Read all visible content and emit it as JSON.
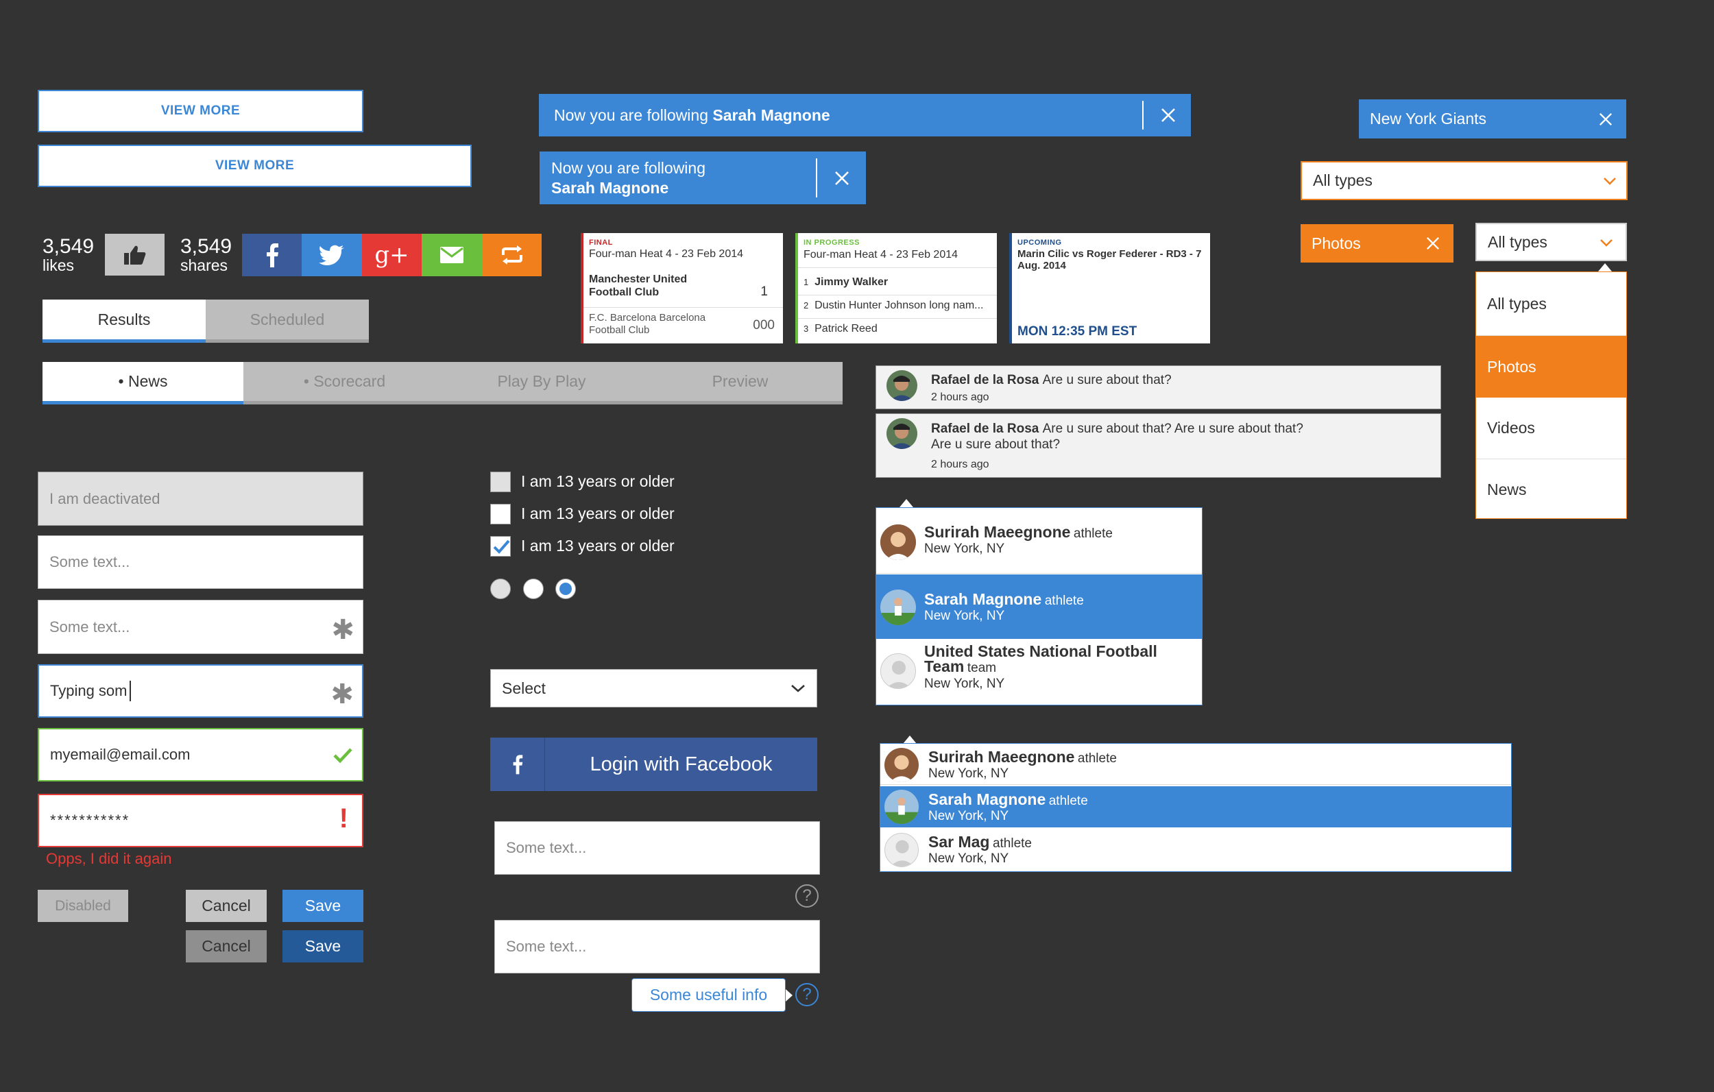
{
  "view_more": {
    "label": "VIEW MORE"
  },
  "follow": {
    "prefix": "Now you are following",
    "prefix2": "Now you are following",
    "name": "Sarah Magnone"
  },
  "team_tag": {
    "label": "New York Giants"
  },
  "filter": {
    "all_types": "All types",
    "photos": "Photos",
    "options": [
      "All types",
      "Photos",
      "Videos",
      "News"
    ]
  },
  "social": {
    "likes_count": "3,549",
    "likes_label": "likes",
    "shares_count": "3,549",
    "shares_label": "shares"
  },
  "colors": {
    "accent": "#3b87d6",
    "orange": "#f07f1c",
    "error": "#e53935",
    "success": "#6abf3c",
    "facebook": "#3a5a99",
    "twitter": "#3b87d6",
    "gplus": "#e53935",
    "email": "#6abf3c",
    "repost": "#f07f1c"
  },
  "result_tabs": {
    "results": "Results",
    "scheduled": "Scheduled"
  },
  "game_tabs": {
    "news": "News",
    "scorecard": "Scorecard",
    "play": "Play By Play",
    "preview": "Preview"
  },
  "cards": [
    {
      "status": "FINAL",
      "event": "Four-man Heat 4 - 23 Feb 2014",
      "team1": "Manchester United Football Club",
      "score1": "1",
      "team2": "F.C. Barcelona Barcelona Football Club",
      "score2": "000"
    },
    {
      "status": "IN PROGRESS",
      "event": "Four-man Heat 4 - 23 Feb 2014",
      "players": [
        {
          "rank": "1",
          "name": "Jimmy Walker"
        },
        {
          "rank": "2",
          "name": "Dustin Hunter Johnson long nam..."
        },
        {
          "rank": "3",
          "name": "Patrick Reed"
        }
      ]
    },
    {
      "status": "UPCOMING",
      "event": "Marin Cilic vs Roger Federer - RD3 - 7 Aug. 2014",
      "time": "MON 12:35 PM EST"
    }
  ],
  "comments": [
    {
      "author": "Rafael de la Rosa",
      "text": "Are u sure about that?",
      "time": "2 hours ago"
    },
    {
      "author": "Rafael de la Rosa",
      "text": "Are u sure about that? Are u sure about that?",
      "text2": "Are u sure about that?",
      "time": "2 hours ago"
    }
  ],
  "inputs": {
    "deactivated": "I am deactivated",
    "placeholder": "Some text...",
    "typing": "Typing som",
    "email": "myemail@email.com",
    "password": "***********",
    "error": "Opps, I did it again"
  },
  "checkbox_label": "I am 13 years or older",
  "select": {
    "label": "Select"
  },
  "facebook_login": {
    "label": "Login with Facebook"
  },
  "useful_info": "Some useful info",
  "buttons": {
    "disabled": "Disabled",
    "cancel": "Cancel",
    "save": "Save"
  },
  "autocomplete1": [
    {
      "name": "Surirah Maeegnone",
      "type": "athlete",
      "location": "New York, NY"
    },
    {
      "name": "Sarah Magnone",
      "type": "athlete",
      "location": "New York, NY"
    },
    {
      "name": "United States National Football",
      "name2": "Team",
      "type": "team",
      "location": "New York, NY"
    }
  ],
  "autocomplete2": [
    {
      "name": "Surirah Maeegnone",
      "type": "athlete",
      "location": "New York, NY"
    },
    {
      "name": "Sarah Magnone",
      "type": "athlete",
      "location": "New York, NY"
    },
    {
      "name": "Sar Mag",
      "type": "athlete",
      "location": "New York, NY"
    }
  ]
}
